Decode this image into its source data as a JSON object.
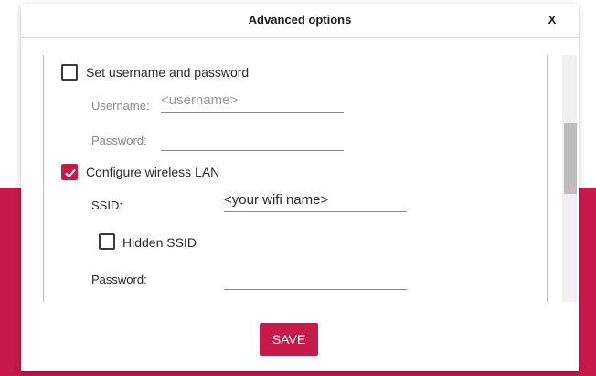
{
  "dialog": {
    "title": "Advanced options",
    "close_label": "X",
    "save_label": "SAVE"
  },
  "user_section": {
    "checkbox_label": "Set username and password",
    "checked": false,
    "username_label": "Username:",
    "username_placeholder": "<username>",
    "password_label": "Password:",
    "password_value": ""
  },
  "wifi_section": {
    "checkbox_label": "Configure wireless LAN",
    "checked": true,
    "ssid_label": "SSID:",
    "ssid_value": "<your wifi name>",
    "hidden_ssid_label": "Hidden SSID",
    "hidden_ssid_checked": false,
    "password_label": "Password:",
    "password_value": ""
  },
  "colors": {
    "accent": "#c51a4a",
    "background_band": "#c51a4a"
  },
  "icons": {
    "check": "check-icon"
  }
}
